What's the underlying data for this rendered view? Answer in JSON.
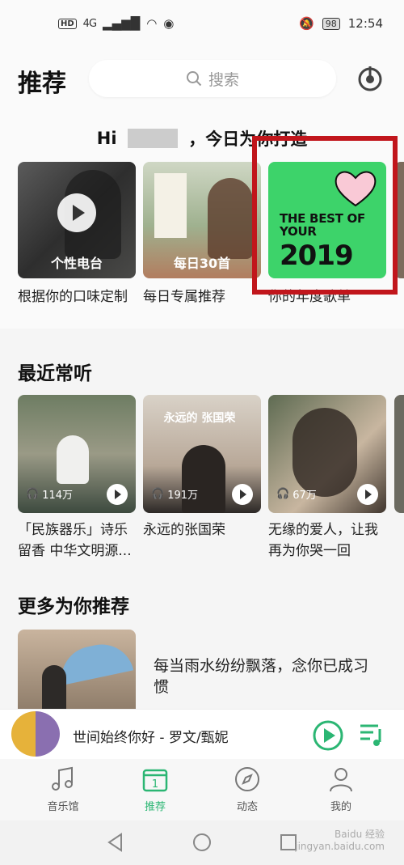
{
  "status_bar": {
    "hd": "HD",
    "signal": "4G",
    "battery": "98",
    "time": "12:54"
  },
  "header": {
    "title": "推荐",
    "search_placeholder": "搜索"
  },
  "greeting": {
    "prefix": "Hi",
    "suffix": "，今日为你打造"
  },
  "recommend_cards": [
    {
      "tag": "个性电台",
      "label": "根据你的口味定制"
    },
    {
      "tag": "每日30首",
      "label": "每日专属推荐"
    },
    {
      "text": "THE BEST OF YOUR",
      "year": "2019",
      "label": "你的年度歌单"
    }
  ],
  "recent": {
    "title": "最近常听",
    "items": [
      {
        "count": "114万",
        "label": "「民族器乐」诗乐留香 中华文明源..."
      },
      {
        "count": "191万",
        "cover_text": "永远的 张国荣",
        "label": "永远的张国荣"
      },
      {
        "count": "67万",
        "label": "无缘的爱人，让我再为你哭一回"
      }
    ]
  },
  "more": {
    "title": "更多为你推荐",
    "item_text": "每当雨水纷纷飘落，念你已成习惯"
  },
  "player": {
    "title": "世间始终你好 - 罗文/甄妮"
  },
  "tabs": [
    {
      "label": "音乐馆",
      "icon": "music-note-icon"
    },
    {
      "label": "推荐",
      "icon": "calendar-icon",
      "active": true,
      "badge": "1"
    },
    {
      "label": "动态",
      "icon": "compass-icon"
    },
    {
      "label": "我的",
      "icon": "person-icon"
    }
  ],
  "watermark": {
    "line1": "Baidu 经验",
    "line2": "jingyan.baidu.com"
  },
  "colors": {
    "accent": "#2bb673",
    "highlight_frame": "#c1161c",
    "best_bg": "#3dd36a"
  }
}
